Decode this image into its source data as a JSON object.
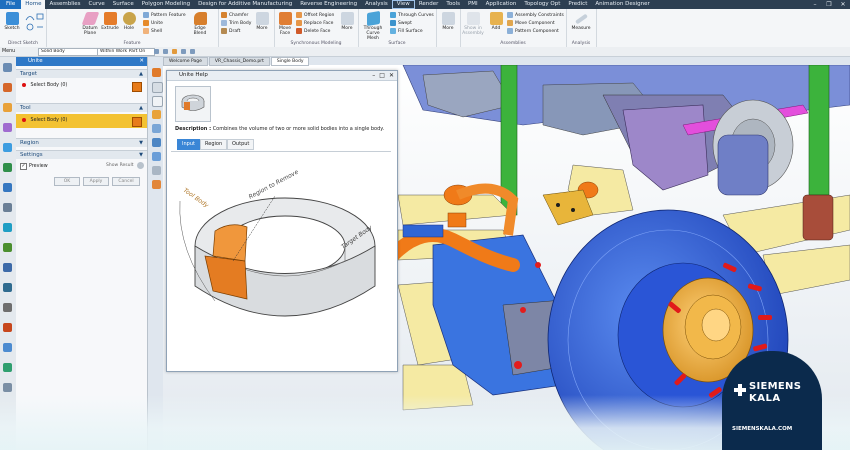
{
  "menu": {
    "items": [
      "File",
      "Home",
      "Assemblies",
      "Curve",
      "Surface",
      "Polygon Modeling",
      "Design for Additive Manufacturing",
      "Reverse Engineering",
      "Analysis",
      "View",
      "Render",
      "Tools",
      "PMI",
      "Application",
      "Topology Opt",
      "Predict",
      "Animation Designer"
    ]
  },
  "ribbon": {
    "groups": {
      "direct_sketch": "Direct Sketch",
      "feature": "Feature",
      "synchronous": "Synchronous Modeling",
      "surface": "Surface",
      "assemblies": "Assemblies",
      "analysis": "Analysis"
    },
    "sketch": "Sketch",
    "datum_plane": "Datum Plane",
    "extrude": "Extrude",
    "hole": "Hole",
    "pattern_feature": "Pattern Feature",
    "unite": "Unite",
    "shell": "Shell",
    "edge_blend": "Edge Blend",
    "chamfer": "Chamfer",
    "trim_body": "Trim Body",
    "draft": "Draft",
    "more": "More",
    "move_face": "Move Face",
    "offset_region": "Offset Region",
    "replace_face": "Replace Face",
    "delete_face": "Delete Face",
    "through_curve_mesh": "Through Curve Mesh",
    "through_curves": "Through Curves",
    "swept": "Swept",
    "fill_surface": "Fill Surface",
    "show_in_assembly": "Show in Assembly",
    "add": "Add",
    "assembly_constraints": "Assembly Constraints",
    "move_component": "Move Component",
    "pattern_component": "Pattern Component",
    "measure": "Measure"
  },
  "toolbar": {
    "menu": "Menu",
    "filter": "Solid Body",
    "scope": "Within Work Part On"
  },
  "doc_tabs": [
    "Welcome Page",
    "VR_Chassis_Demo.prt",
    "Single Body"
  ],
  "unite": {
    "title": "Unite",
    "target_label": "Target",
    "target_select": "Select Body (0)",
    "tool_label": "Tool",
    "tool_select": "Select Body (0)",
    "region_label": "Region",
    "settings_label": "Settings",
    "preview_label": "Preview",
    "show_result": "Show Result",
    "ok": "OK",
    "apply": "Apply",
    "cancel": "Cancel"
  },
  "help": {
    "title": "Unite Help",
    "description_label": "Description :",
    "description_text": "Combines the volume of two or more solid bodies into a single body.",
    "tabs": [
      "Input",
      "Region",
      "Output"
    ],
    "label_target": "Target Body",
    "label_region": "Region to Remove",
    "label_tool": "Tool Body"
  },
  "logo": {
    "line1": "SIEMENS",
    "line2": "KALA",
    "url": "SIEMENSKALA.COM"
  },
  "colors": {
    "accent": "#2e78c7",
    "tool_highlight": "#f3c232",
    "brand_bg": "#0b2a4c"
  }
}
